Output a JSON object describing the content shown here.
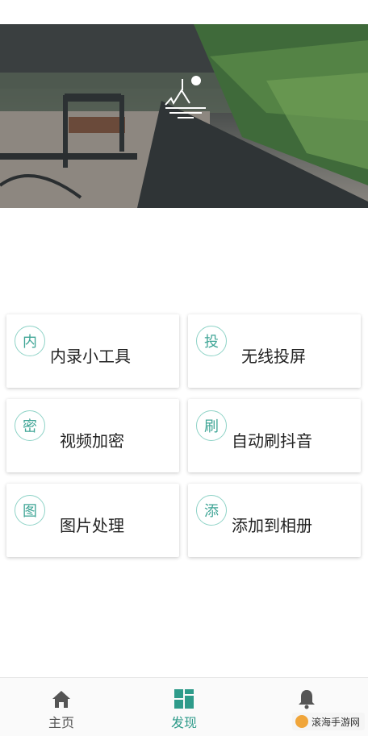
{
  "cards": [
    {
      "badge": "内",
      "label": "内录小工具"
    },
    {
      "badge": "投",
      "label": "无线投屏"
    },
    {
      "badge": "密",
      "label": "视频加密"
    },
    {
      "badge": "刷",
      "label": "自动刷抖音"
    },
    {
      "badge": "图",
      "label": "图片处理"
    },
    {
      "badge": "添",
      "label": "添加到相册"
    }
  ],
  "tabs": [
    {
      "label": "主页",
      "icon": "home-icon",
      "active": false
    },
    {
      "label": "发现",
      "icon": "grid-icon",
      "active": true
    },
    {
      "label": "消息",
      "icon": "bell-icon",
      "active": false
    }
  ],
  "watermark": "滚海手游网",
  "colors": {
    "accent": "#2e9b8a",
    "badge_border": "#8fd3c7"
  }
}
